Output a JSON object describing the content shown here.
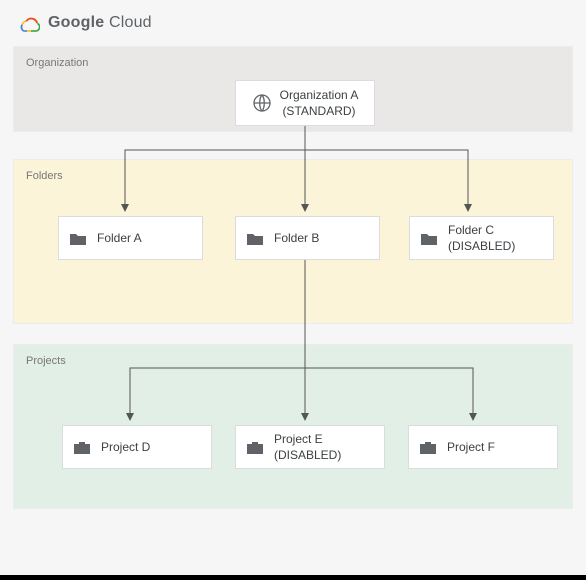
{
  "brand": {
    "word1": "Google",
    "word2": "Cloud"
  },
  "zones": {
    "org_label": "Organization",
    "folders_label": "Folders",
    "projects_label": "Projects"
  },
  "nodes": {
    "org": {
      "line1": "Organization A",
      "line2": "(STANDARD)"
    },
    "folderA": "Folder A",
    "folderB": "Folder B",
    "folderC": {
      "line1": "Folder C",
      "line2": "(DISABLED)"
    },
    "projectD": "Project D",
    "projectE": {
      "line1": "Project E",
      "line2": "(DISABLED)"
    },
    "projectF": "Project F"
  },
  "chart_data": {
    "type": "tree",
    "root": {
      "label": "Organization A (STANDARD)",
      "type": "organization",
      "children": [
        {
          "label": "Folder A",
          "type": "folder"
        },
        {
          "label": "Folder B",
          "type": "folder",
          "children": [
            {
              "label": "Project D",
              "type": "project"
            },
            {
              "label": "Project E (DISABLED)",
              "type": "project"
            },
            {
              "label": "Project F",
              "type": "project"
            }
          ]
        },
        {
          "label": "Folder C (DISABLED)",
          "type": "folder"
        }
      ]
    },
    "groups": [
      "Organization",
      "Folders",
      "Projects"
    ]
  }
}
